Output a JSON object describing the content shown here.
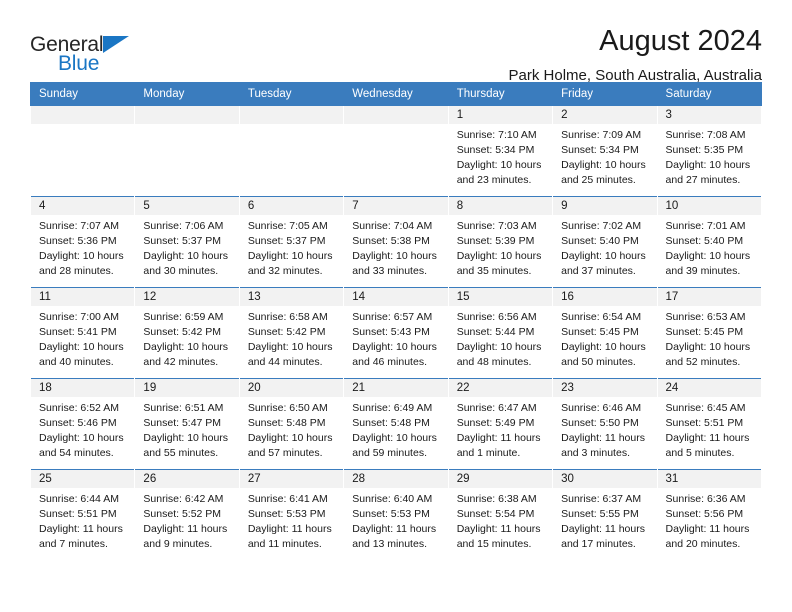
{
  "brand": {
    "name_top": "General",
    "name_bottom": "Blue",
    "triangle_icon": "brand-triangle-icon",
    "accent_color": "#1a76c4"
  },
  "header": {
    "title": "August 2024",
    "subtitle": "Park Holme, South Australia, Australia"
  },
  "calendar": {
    "header_bg": "#3a7cbe",
    "daynum_bg": "#f2f2f2",
    "weekdays": [
      "Sunday",
      "Monday",
      "Tuesday",
      "Wednesday",
      "Thursday",
      "Friday",
      "Saturday"
    ],
    "weeks": [
      [
        {
          "day": "",
          "sunrise": "",
          "sunset": "",
          "daylight1": "",
          "daylight2": ""
        },
        {
          "day": "",
          "sunrise": "",
          "sunset": "",
          "daylight1": "",
          "daylight2": ""
        },
        {
          "day": "",
          "sunrise": "",
          "sunset": "",
          "daylight1": "",
          "daylight2": ""
        },
        {
          "day": "",
          "sunrise": "",
          "sunset": "",
          "daylight1": "",
          "daylight2": ""
        },
        {
          "day": "1",
          "sunrise": "Sunrise: 7:10 AM",
          "sunset": "Sunset: 5:34 PM",
          "daylight1": "Daylight: 10 hours",
          "daylight2": "and 23 minutes."
        },
        {
          "day": "2",
          "sunrise": "Sunrise: 7:09 AM",
          "sunset": "Sunset: 5:34 PM",
          "daylight1": "Daylight: 10 hours",
          "daylight2": "and 25 minutes."
        },
        {
          "day": "3",
          "sunrise": "Sunrise: 7:08 AM",
          "sunset": "Sunset: 5:35 PM",
          "daylight1": "Daylight: 10 hours",
          "daylight2": "and 27 minutes."
        }
      ],
      [
        {
          "day": "4",
          "sunrise": "Sunrise: 7:07 AM",
          "sunset": "Sunset: 5:36 PM",
          "daylight1": "Daylight: 10 hours",
          "daylight2": "and 28 minutes."
        },
        {
          "day": "5",
          "sunrise": "Sunrise: 7:06 AM",
          "sunset": "Sunset: 5:37 PM",
          "daylight1": "Daylight: 10 hours",
          "daylight2": "and 30 minutes."
        },
        {
          "day": "6",
          "sunrise": "Sunrise: 7:05 AM",
          "sunset": "Sunset: 5:37 PM",
          "daylight1": "Daylight: 10 hours",
          "daylight2": "and 32 minutes."
        },
        {
          "day": "7",
          "sunrise": "Sunrise: 7:04 AM",
          "sunset": "Sunset: 5:38 PM",
          "daylight1": "Daylight: 10 hours",
          "daylight2": "and 33 minutes."
        },
        {
          "day": "8",
          "sunrise": "Sunrise: 7:03 AM",
          "sunset": "Sunset: 5:39 PM",
          "daylight1": "Daylight: 10 hours",
          "daylight2": "and 35 minutes."
        },
        {
          "day": "9",
          "sunrise": "Sunrise: 7:02 AM",
          "sunset": "Sunset: 5:40 PM",
          "daylight1": "Daylight: 10 hours",
          "daylight2": "and 37 minutes."
        },
        {
          "day": "10",
          "sunrise": "Sunrise: 7:01 AM",
          "sunset": "Sunset: 5:40 PM",
          "daylight1": "Daylight: 10 hours",
          "daylight2": "and 39 minutes."
        }
      ],
      [
        {
          "day": "11",
          "sunrise": "Sunrise: 7:00 AM",
          "sunset": "Sunset: 5:41 PM",
          "daylight1": "Daylight: 10 hours",
          "daylight2": "and 40 minutes."
        },
        {
          "day": "12",
          "sunrise": "Sunrise: 6:59 AM",
          "sunset": "Sunset: 5:42 PM",
          "daylight1": "Daylight: 10 hours",
          "daylight2": "and 42 minutes."
        },
        {
          "day": "13",
          "sunrise": "Sunrise: 6:58 AM",
          "sunset": "Sunset: 5:42 PM",
          "daylight1": "Daylight: 10 hours",
          "daylight2": "and 44 minutes."
        },
        {
          "day": "14",
          "sunrise": "Sunrise: 6:57 AM",
          "sunset": "Sunset: 5:43 PM",
          "daylight1": "Daylight: 10 hours",
          "daylight2": "and 46 minutes."
        },
        {
          "day": "15",
          "sunrise": "Sunrise: 6:56 AM",
          "sunset": "Sunset: 5:44 PM",
          "daylight1": "Daylight: 10 hours",
          "daylight2": "and 48 minutes."
        },
        {
          "day": "16",
          "sunrise": "Sunrise: 6:54 AM",
          "sunset": "Sunset: 5:45 PM",
          "daylight1": "Daylight: 10 hours",
          "daylight2": "and 50 minutes."
        },
        {
          "day": "17",
          "sunrise": "Sunrise: 6:53 AM",
          "sunset": "Sunset: 5:45 PM",
          "daylight1": "Daylight: 10 hours",
          "daylight2": "and 52 minutes."
        }
      ],
      [
        {
          "day": "18",
          "sunrise": "Sunrise: 6:52 AM",
          "sunset": "Sunset: 5:46 PM",
          "daylight1": "Daylight: 10 hours",
          "daylight2": "and 54 minutes."
        },
        {
          "day": "19",
          "sunrise": "Sunrise: 6:51 AM",
          "sunset": "Sunset: 5:47 PM",
          "daylight1": "Daylight: 10 hours",
          "daylight2": "and 55 minutes."
        },
        {
          "day": "20",
          "sunrise": "Sunrise: 6:50 AM",
          "sunset": "Sunset: 5:48 PM",
          "daylight1": "Daylight: 10 hours",
          "daylight2": "and 57 minutes."
        },
        {
          "day": "21",
          "sunrise": "Sunrise: 6:49 AM",
          "sunset": "Sunset: 5:48 PM",
          "daylight1": "Daylight: 10 hours",
          "daylight2": "and 59 minutes."
        },
        {
          "day": "22",
          "sunrise": "Sunrise: 6:47 AM",
          "sunset": "Sunset: 5:49 PM",
          "daylight1": "Daylight: 11 hours",
          "daylight2": "and 1 minute."
        },
        {
          "day": "23",
          "sunrise": "Sunrise: 6:46 AM",
          "sunset": "Sunset: 5:50 PM",
          "daylight1": "Daylight: 11 hours",
          "daylight2": "and 3 minutes."
        },
        {
          "day": "24",
          "sunrise": "Sunrise: 6:45 AM",
          "sunset": "Sunset: 5:51 PM",
          "daylight1": "Daylight: 11 hours",
          "daylight2": "and 5 minutes."
        }
      ],
      [
        {
          "day": "25",
          "sunrise": "Sunrise: 6:44 AM",
          "sunset": "Sunset: 5:51 PM",
          "daylight1": "Daylight: 11 hours",
          "daylight2": "and 7 minutes."
        },
        {
          "day": "26",
          "sunrise": "Sunrise: 6:42 AM",
          "sunset": "Sunset: 5:52 PM",
          "daylight1": "Daylight: 11 hours",
          "daylight2": "and 9 minutes."
        },
        {
          "day": "27",
          "sunrise": "Sunrise: 6:41 AM",
          "sunset": "Sunset: 5:53 PM",
          "daylight1": "Daylight: 11 hours",
          "daylight2": "and 11 minutes."
        },
        {
          "day": "28",
          "sunrise": "Sunrise: 6:40 AM",
          "sunset": "Sunset: 5:53 PM",
          "daylight1": "Daylight: 11 hours",
          "daylight2": "and 13 minutes."
        },
        {
          "day": "29",
          "sunrise": "Sunrise: 6:38 AM",
          "sunset": "Sunset: 5:54 PM",
          "daylight1": "Daylight: 11 hours",
          "daylight2": "and 15 minutes."
        },
        {
          "day": "30",
          "sunrise": "Sunrise: 6:37 AM",
          "sunset": "Sunset: 5:55 PM",
          "daylight1": "Daylight: 11 hours",
          "daylight2": "and 17 minutes."
        },
        {
          "day": "31",
          "sunrise": "Sunrise: 6:36 AM",
          "sunset": "Sunset: 5:56 PM",
          "daylight1": "Daylight: 11 hours",
          "daylight2": "and 20 minutes."
        }
      ]
    ]
  }
}
